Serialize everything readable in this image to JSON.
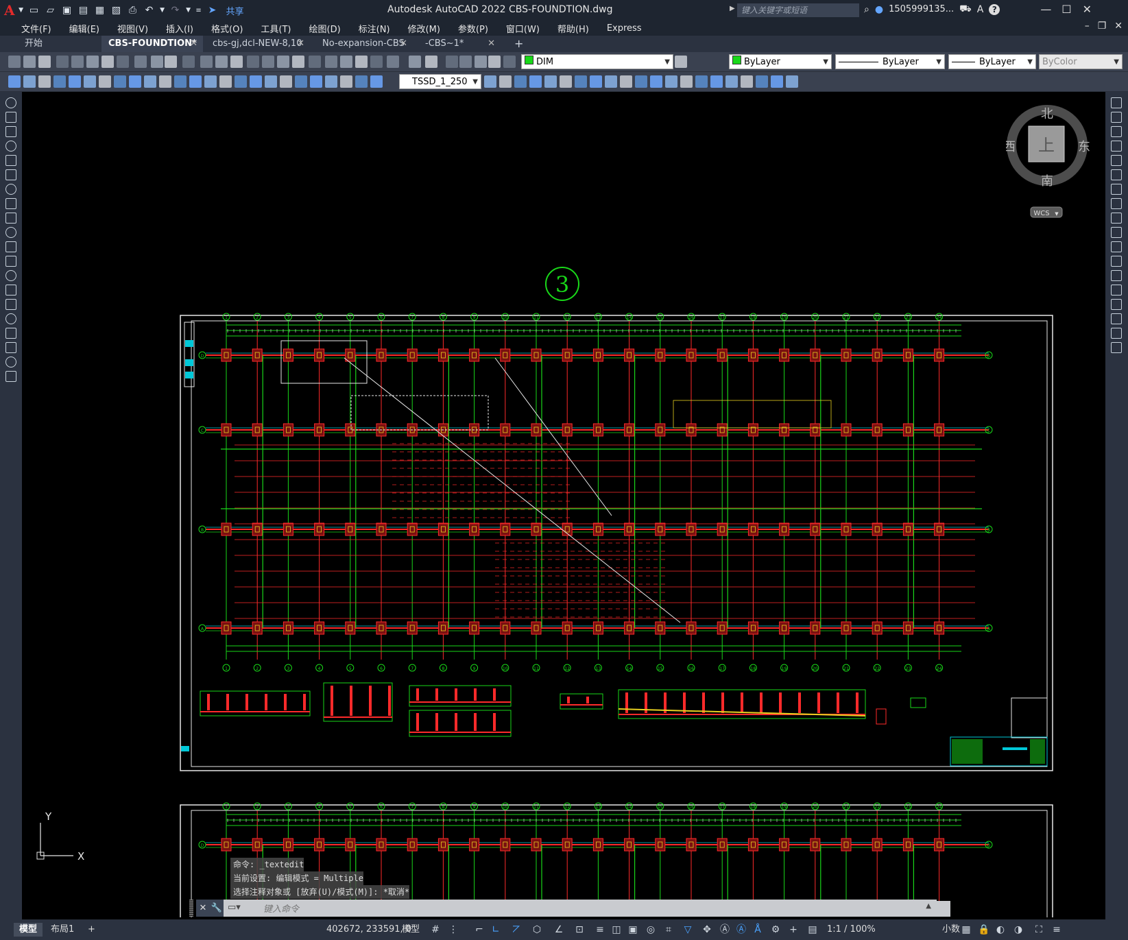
{
  "app": {
    "logo": "A",
    "title": "Autodesk AutoCAD 2022    CBS-FOUNDTION.dwg",
    "share_label": "共享",
    "search_placeholder": "键入关键字或短语",
    "user": "1505999135...",
    "help": "?"
  },
  "menu": [
    "文件(F)",
    "编辑(E)",
    "视图(V)",
    "插入(I)",
    "格式(O)",
    "工具(T)",
    "绘图(D)",
    "标注(N)",
    "修改(M)",
    "参数(P)",
    "窗口(W)",
    "帮助(H)",
    "Express"
  ],
  "tabs": [
    {
      "label": "开始",
      "active": false,
      "closable": false
    },
    {
      "label": "CBS-FOUNDTION*",
      "active": true,
      "closable": true
    },
    {
      "label": "cbs-gj,dcl-NEW-8,10",
      "active": false,
      "closable": true
    },
    {
      "label": "No-expansion-CBS",
      "active": false,
      "closable": true
    },
    {
      "label": "-CBS~1*",
      "active": false,
      "closable": true
    }
  ],
  "toolbar": {
    "layer_name": "DIM",
    "color": "ByLayer",
    "linetype": "ByLayer",
    "lineweight": "ByLayer",
    "plotstyle": "ByColor",
    "dimstyle": "TSSD_1_250"
  },
  "viewcube": {
    "north": "北",
    "south": "南",
    "east": "东",
    "west": "西",
    "face": "上",
    "wcs": "WCS"
  },
  "drawing": {
    "section_marker": "3",
    "axis_top": [
      "1",
      "2",
      "3",
      "4",
      "5",
      "6",
      "7",
      "8",
      "9",
      "10",
      "11",
      "12",
      "13",
      "14",
      "15",
      "16",
      "17",
      "18",
      "19",
      "20",
      "21",
      "22",
      "23",
      "24"
    ],
    "axis_side": [
      "D",
      "C",
      "B",
      "A"
    ]
  },
  "ucs": {
    "y": "Y",
    "x": "X"
  },
  "command": {
    "history": [
      "命令: _textedit",
      "当前设置: 编辑模式 = Multiple",
      "选择注释对象或 [放弃(U)/模式(M)]: *取消*"
    ],
    "placeholder": "键入命令"
  },
  "status": {
    "model_tab": "模型",
    "layout_tab": "布局1",
    "coords": "402672, 233591, 0",
    "model_label": "模型",
    "scale": "1:1 / 100%",
    "units": "小数"
  },
  "colors": {
    "red": "#ff2a2a",
    "green": "#19d819",
    "cyan": "#00c8d8",
    "white": "#e8e8e8",
    "chrome": "#2b3240"
  }
}
